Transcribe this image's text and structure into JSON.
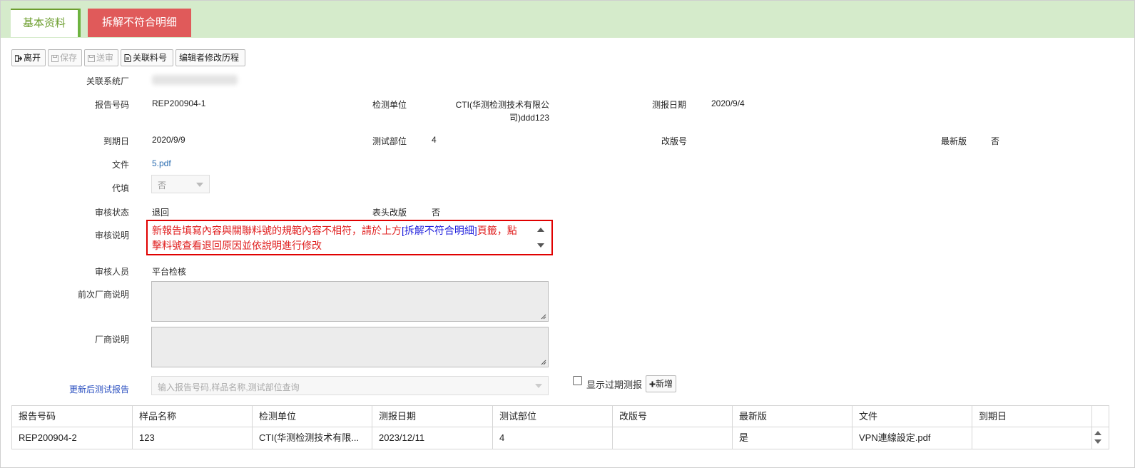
{
  "tabs": {
    "basic": "基本资料",
    "nonconform": "拆解不符合明细"
  },
  "toolbar": {
    "leave": "离开",
    "save": "保存",
    "submit": "送审",
    "related_part": "关联料号",
    "edit_history": "编辑者修改历程"
  },
  "form": {
    "related_factory_label": "关联系统厂",
    "report_no_label": "报告号码",
    "report_no": "REP200904-1",
    "test_unit_label": "检测单位",
    "test_unit_line1": "CTI(华测检测技术有限公",
    "test_unit_line2": "司)ddd123",
    "report_date_label": "测报日期",
    "report_date": "2020/9/4",
    "expiry_label": "到期日",
    "expiry": "2020/9/9",
    "test_part_label": "测试部位",
    "test_part": "4",
    "revision_label": "改版号",
    "revision": "",
    "latest_label": "最新版",
    "latest": "否",
    "file_label": "文件",
    "file": "5.pdf",
    "proxy_label": "代填",
    "proxy": "否",
    "review_status_label": "审核状态",
    "review_status": "退回",
    "header_rev_label": "表头改版",
    "header_rev": "否",
    "review_note_label": "审核说明",
    "review_note_part1": "新報告填寫內容與關聯料號的規範內容不相符，請於上方",
    "review_note_link": "[拆解不符合明細]",
    "review_note_part2": "頁籤，點擊料號查看退回原因並依說明進行修改",
    "reviewer_label": "审核人员",
    "reviewer": "平台检核",
    "prev_vendor_note_label": "前次厂商说明",
    "vendor_note_label": "厂商说明",
    "updated_report_label": "更新后测试报告",
    "search_placeholder": "输入报告号码,样品名称,测试部位查询",
    "show_expired": "显示过期测报",
    "add": "新增"
  },
  "table": {
    "headers": [
      "报告号码",
      "样品名称",
      "检测单位",
      "测报日期",
      "测试部位",
      "改版号",
      "最新版",
      "文件",
      "到期日"
    ],
    "row": [
      "REP200904-2",
      "123",
      "CTI(华测检测技术有限...",
      "2023/12/11",
      "4",
      "",
      "是",
      "VPN連線設定.pdf",
      ""
    ]
  },
  "colors": {
    "tab_bar": "#d5ebcb",
    "tab_active_text": "#6d9e2f",
    "tab_alert": "#e05a5a",
    "note_border": "#e00000",
    "link": "#2a6cb0"
  }
}
